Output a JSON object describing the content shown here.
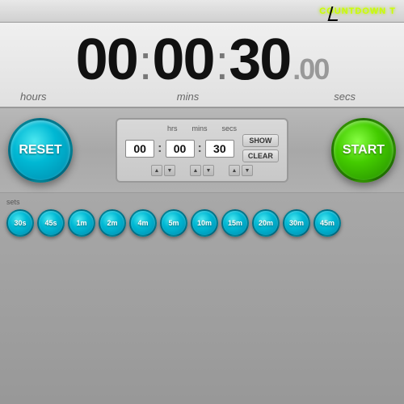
{
  "app": {
    "title": "COUNTDOWN T"
  },
  "display": {
    "hours": "00",
    "mins": "00",
    "secs": "30",
    "ms": "00",
    "label_hours": "hours",
    "label_mins": "mins",
    "label_secs": "secs"
  },
  "controls": {
    "reset_label": "RESET",
    "start_label": "START",
    "show_label": "SHOW",
    "clear_label": "CLEAR",
    "input_hours": "00",
    "input_mins": "00",
    "input_secs": "30",
    "label_hrs": "hrs",
    "label_mins": "mins",
    "label_secs": "secs"
  },
  "presets": {
    "section_label": "sets",
    "items": [
      {
        "label": "30s"
      },
      {
        "label": "45s"
      },
      {
        "label": "1m"
      },
      {
        "label": "2m"
      },
      {
        "label": "4m"
      },
      {
        "label": "5m"
      },
      {
        "label": "10m"
      },
      {
        "label": "15m"
      },
      {
        "label": "20m"
      },
      {
        "label": "30m"
      },
      {
        "label": "45m"
      }
    ]
  }
}
